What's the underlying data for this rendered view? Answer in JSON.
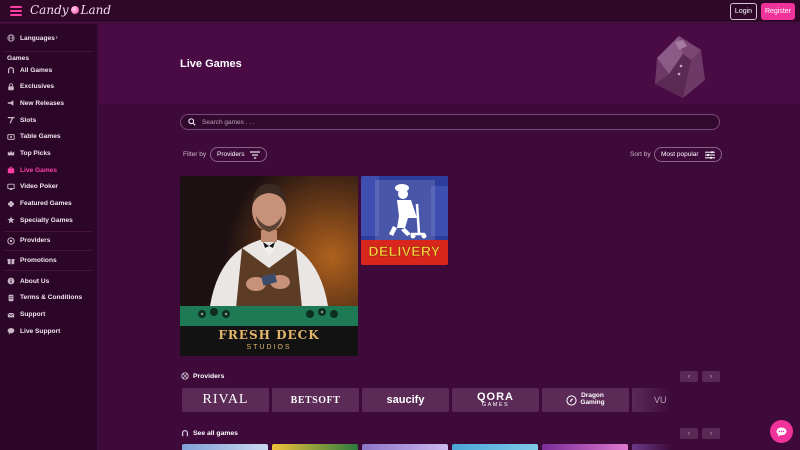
{
  "header": {
    "logo_text": "Candy Land",
    "login_label": "Login",
    "register_label": "Register"
  },
  "sidebar": {
    "languages_label": "Languages",
    "games_heading": "Games",
    "games_items": [
      {
        "label": "All Games",
        "icon": "horseshoe-icon"
      },
      {
        "label": "Exclusives",
        "icon": "lock-icon"
      },
      {
        "label": "New Releases",
        "icon": "megaphone-icon"
      },
      {
        "label": "Slots",
        "icon": "slot-lever-icon"
      },
      {
        "label": "Table Games",
        "icon": "table-icon"
      },
      {
        "label": "Top Picks",
        "icon": "crown-icon"
      },
      {
        "label": "Live Games",
        "icon": "live-dealer-icon",
        "active": true
      },
      {
        "label": "Video Poker",
        "icon": "monitor-icon"
      },
      {
        "label": "Featured Games",
        "icon": "clover-icon"
      },
      {
        "label": "Specialty Games",
        "icon": "star-badge-icon"
      }
    ],
    "providers_label": "Providers",
    "promotions_label": "Promotions",
    "footer_items": [
      {
        "label": "About Us",
        "icon": "info-icon"
      },
      {
        "label": "Terms & Conditions",
        "icon": "document-icon"
      },
      {
        "label": "Support",
        "icon": "mail-icon"
      },
      {
        "label": "Live Support",
        "icon": "chat-icon"
      }
    ]
  },
  "hero": {
    "title": "Live Games"
  },
  "search": {
    "placeholder": "Search games . . ."
  },
  "filters": {
    "filter_by_label": "Filter by",
    "providers_button": "Providers",
    "sort_by_label": "Sort by",
    "sort_value": "Most popular"
  },
  "games": [
    {
      "name": "Fresh Deck Studios",
      "logo_line1": "FRESH DECK",
      "logo_line2": "STUDIOS"
    },
    {
      "name": "Delivery",
      "logo_text": "DELIVERY"
    }
  ],
  "providers_section": {
    "title": "Providers",
    "prev": "‹",
    "next": "›",
    "items": [
      "RIVAL",
      "BETSOFT",
      "saucify",
      "QORA",
      "GAMES",
      "Dragon",
      "Gaming",
      "VU"
    ]
  },
  "all_games_section": {
    "title": "See all games",
    "prev": "‹",
    "next": "›"
  },
  "colors": {
    "accent": "#f0339a",
    "background": "#3d0a39",
    "sidebar": "#2b0628",
    "hero": "#4a0b45"
  }
}
